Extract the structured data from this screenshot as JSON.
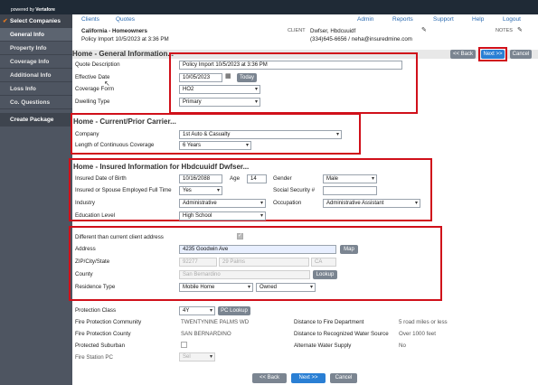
{
  "brand": {
    "powered_by": "powered by",
    "vendor": "Vertafore"
  },
  "nav": {
    "clients": "Clients",
    "quotes": "Quotes",
    "admin": "Admin",
    "reports": "Reports",
    "support": "Support",
    "help": "Help",
    "logout": "Logout"
  },
  "client": {
    "line_of_business": "California - Homeowners",
    "policy_import": "Policy Import 10/5/2023 at 3:36 PM",
    "client_label": "CLIENT",
    "client_name": "Dwfser, Hbdcuuidf",
    "contact": "(334)645-6656 / neha@insuredmine.com",
    "notes_label": "NOTES"
  },
  "sidebar": {
    "items": [
      {
        "label": "Select Companies"
      },
      {
        "label": "General Info"
      },
      {
        "label": "Property Info"
      },
      {
        "label": "Coverage Info"
      },
      {
        "label": "Additional Info"
      },
      {
        "label": "Loss Info"
      },
      {
        "label": "Co. Questions"
      },
      {
        "label": "Create Package"
      }
    ]
  },
  "buttons": {
    "back": "<< Back",
    "next": "Next >>",
    "cancel": "Cancel",
    "today": "Today",
    "map": "Map",
    "lookup": "Lookup",
    "pc_lookup": "PC Lookup"
  },
  "general": {
    "title": "Home - General Information...",
    "quote_desc_label": "Quote Description",
    "quote_desc": "Policy Import 10/5/2023 at 3:36 PM",
    "eff_date_label": "Effective Date",
    "eff_date": "10/05/2023",
    "coverage_form_label": "Coverage Form",
    "coverage_form": "HO2",
    "dwelling_type_label": "Dwelling Type",
    "dwelling_type": "Primary"
  },
  "carrier": {
    "title": "Home - Current/Prior Carrier...",
    "company_label": "Company",
    "company": "1st Auto & Casualty",
    "length_label": "Length of Continuous Coverage",
    "length": "6 Years"
  },
  "insured": {
    "title": "Home - Insured Information for Hbdcuuidf Dwfser...",
    "dob_label": "Insured Date of Birth",
    "dob": "10/16/2088",
    "age_label": "Age",
    "age": "14",
    "gender_label": "Gender",
    "gender": "Male",
    "employed_label": "Insured or Spouse Employed Full Time",
    "employed": "Yes",
    "ssn_label": "Social Security #",
    "ssn": "",
    "industry_label": "Industry",
    "industry": "Administrative",
    "occupation_label": "Occupation",
    "occupation": "Administrative Assistant",
    "education_label": "Education Level",
    "education": "High School"
  },
  "address": {
    "diff_label": "Different than current client address",
    "address_label": "Address",
    "address": "4235 Goodwin Ave",
    "zip_label": "ZIP/City/State",
    "zip": "92277",
    "city": "29 Palms",
    "state": "CA",
    "county_label": "County",
    "county": "San Bernardino",
    "residence_label": "Residence Type",
    "residence": "Mobile Home",
    "ownership": "Owned"
  },
  "protection": {
    "class_label": "Protection Class",
    "class": "4Y",
    "community_label": "Fire Protection Community",
    "community": "TWENTYNINE PALMS WD",
    "county_label": "Fire Protection County",
    "county": "SAN BERNARDINO",
    "suburban_label": "Protected Suburban",
    "station_label": "Fire Station PC",
    "station": "Sel",
    "dist_dept_label": "Distance to Fire Department",
    "dist_dept": "5 road miles or less",
    "dist_water_label": "Distance to Recognized Water Source",
    "dist_water": "Over 1000 feet",
    "alt_water_label": "Alternate Water Supply",
    "alt_water": "No"
  }
}
